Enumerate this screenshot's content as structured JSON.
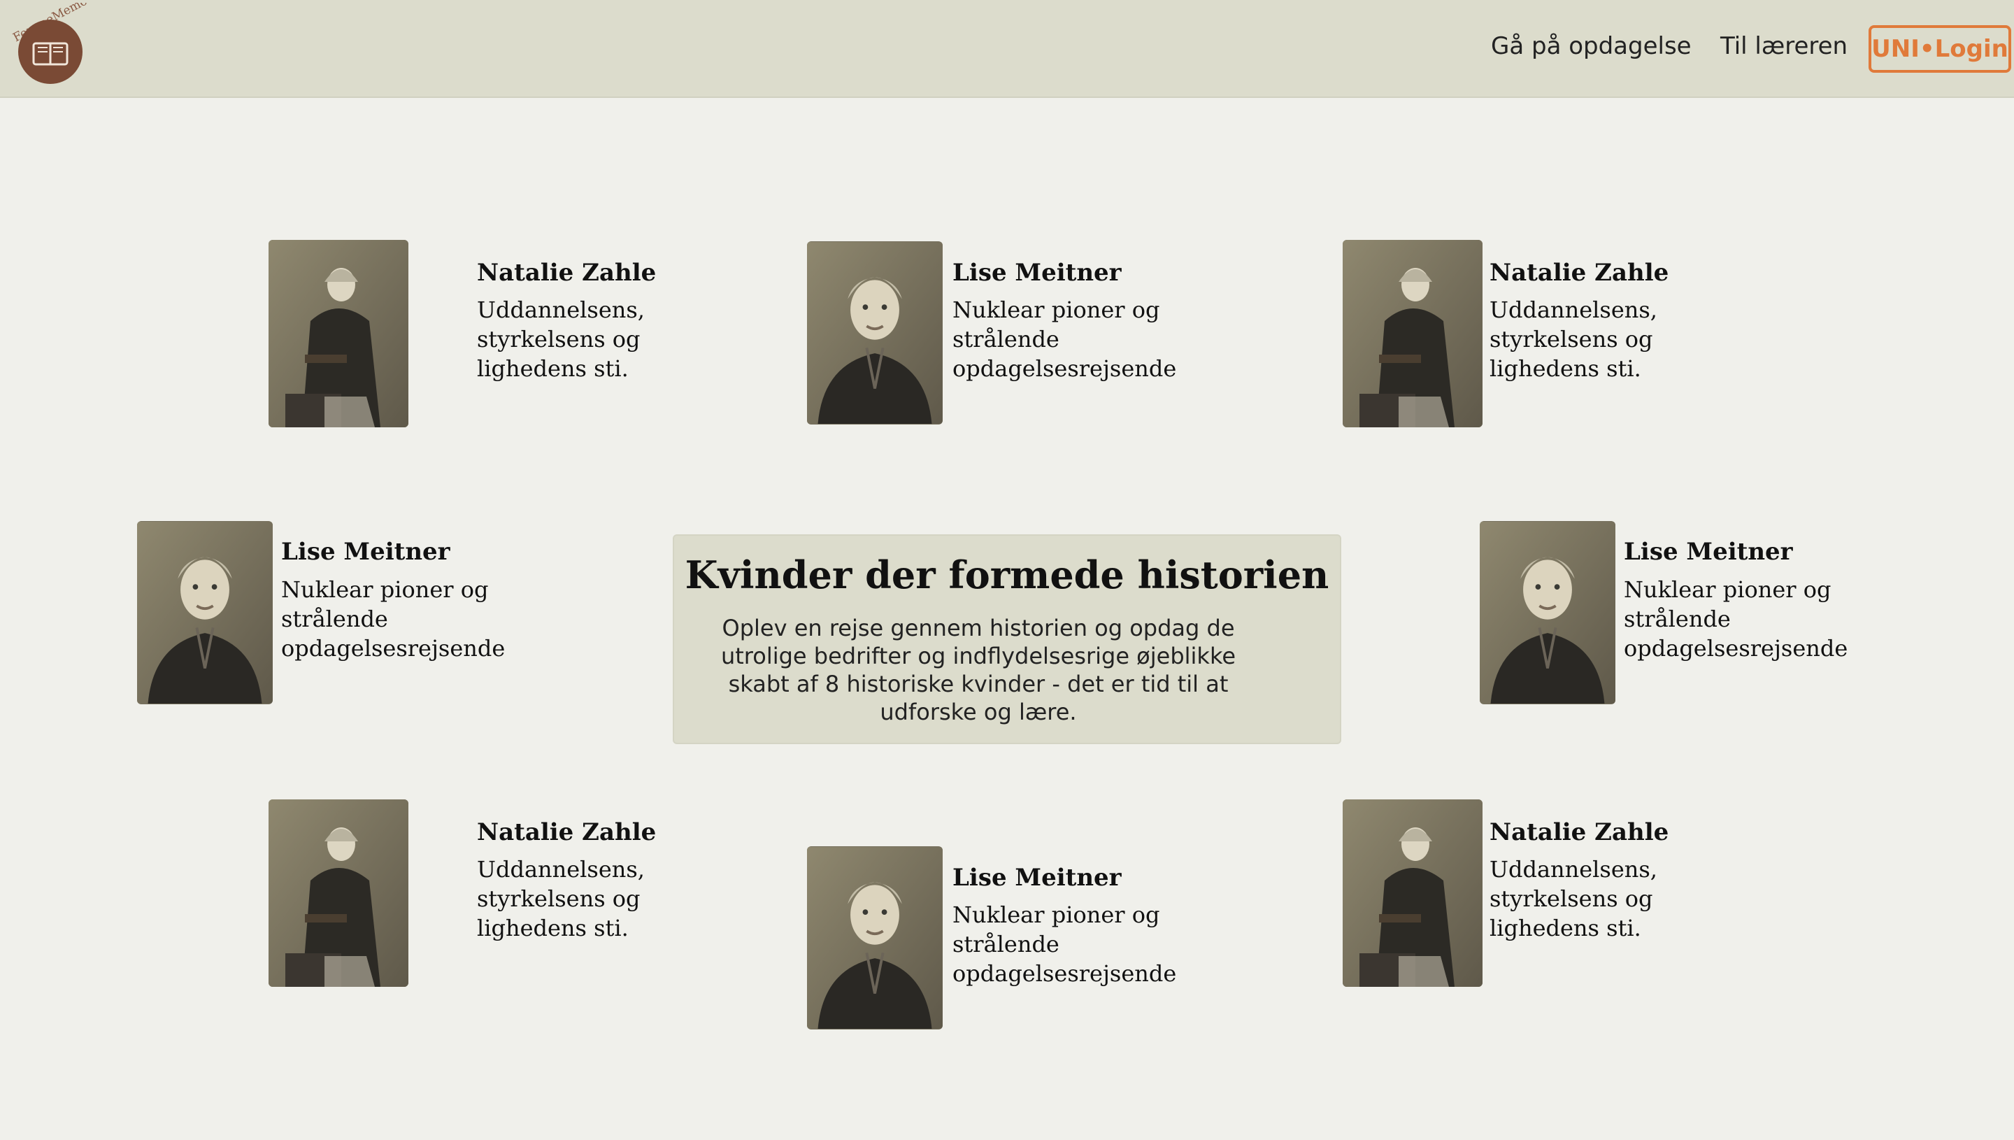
{
  "header": {
    "logo_text": "FemmeMemo",
    "nav": [
      "Gå på opdagelse",
      "Til læreren"
    ],
    "login_label": "UNI•Login",
    "accent_color": "#e07a3a"
  },
  "hero": {
    "title": "Kvinder der formede historien",
    "text": "Oplev en rejse gennem historien og opdag de utrolige bedrifter og indflydelsesrige øjeblikke skabt af 8 historiske kvinder - det er tid til at udforske og lære."
  },
  "cards": [
    {
      "name": "Natalie Zahle",
      "desc": "Uddannelsens, styrkelsens og lighedens sti.",
      "portrait": "standing-woman-portrait"
    },
    {
      "name": "Lise Meitner",
      "desc": "Nuklear pioner og strålende opdagelsesrejsende",
      "portrait": "seated-woman-portrait"
    },
    {
      "name": "Natalie Zahle",
      "desc": "Uddannelsens, styrkelsens og lighedens sti.",
      "portrait": "standing-woman-portrait"
    },
    {
      "name": "Lise Meitner",
      "desc": "Nuklear pioner og strålende opdagelsesrejsende",
      "portrait": "seated-woman-portrait"
    },
    {
      "name": "Lise Meitner",
      "desc": "Nuklear pioner og strålende opdagelsesrejsende",
      "portrait": "seated-woman-portrait"
    },
    {
      "name": "Natalie Zahle",
      "desc": "Uddannelsens, styrkelsens og lighedens sti.",
      "portrait": "standing-woman-portrait"
    },
    {
      "name": "Lise Meitner",
      "desc": "Nuklear pioner og strålende opdagelsesrejsende",
      "portrait": "seated-woman-portrait"
    },
    {
      "name": "Natalie Zahle",
      "desc": "Uddannelsens, styrkelsens og lighedens sti.",
      "portrait": "standing-woman-portrait"
    }
  ]
}
